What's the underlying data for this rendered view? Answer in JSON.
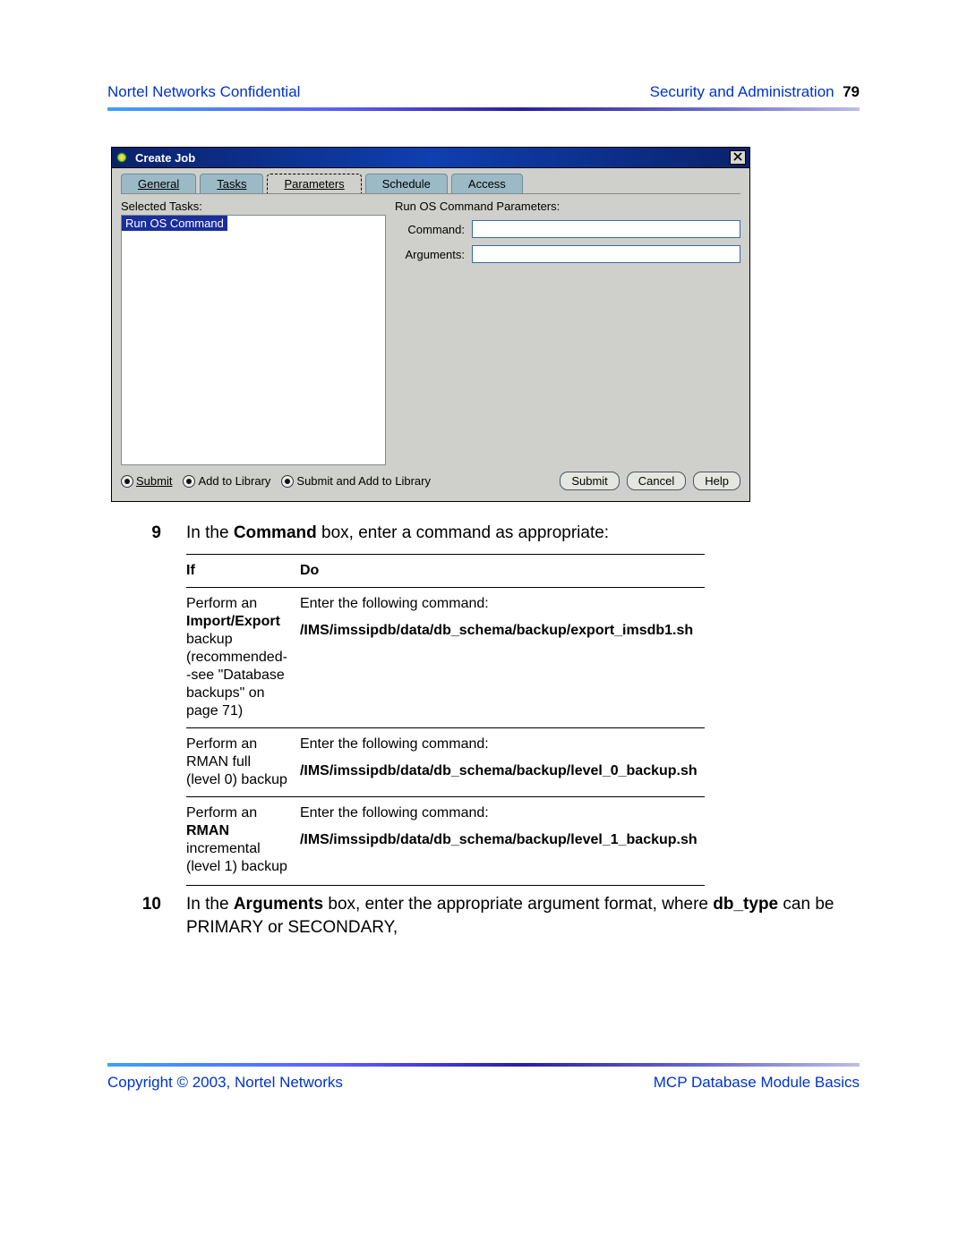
{
  "header": {
    "left": "Nortel Networks Confidential",
    "section": "Security and Administration",
    "page": "79"
  },
  "window": {
    "title": "Create Job",
    "tabs": {
      "general": "General",
      "tasks": "Tasks",
      "parameters": "Parameters",
      "schedule": "Schedule",
      "access": "Access"
    },
    "selectedTasksLabel": "Selected Tasks:",
    "selectedTaskItem": "Run OS Command",
    "paramsHeader": "Run OS Command Parameters:",
    "commandLabel": "Command:",
    "argumentsLabel": "Arguments:",
    "commandValue": "",
    "argumentsValue": "",
    "radios": {
      "submit": "Submit",
      "addlib": "Add to Library",
      "both": "Submit and Add to Library"
    },
    "buttons": {
      "submit": "Submit",
      "cancel": "Cancel",
      "help": "Help"
    }
  },
  "steps": {
    "s9": {
      "num": "9",
      "pre": "In the ",
      "bold": "Command",
      "post": " box, enter a command as appropriate:"
    },
    "tableHeader": {
      "if": "If",
      "do": "Do"
    },
    "rows": [
      {
        "if_pre": "Perform an ",
        "if_bold": "Import/Export",
        "if_post": " backup (recommended--see \"Database backups\" on page 71)",
        "do_lead": "Enter the following command:",
        "do_cmd": "/IMS/imssipdb/data/db_schema/backup/export_imsdb1.sh"
      },
      {
        "if_pre": "Perform an RMAN full (level 0) backup",
        "if_bold": "",
        "if_post": "",
        "do_lead": "Enter the following command:",
        "do_cmd": "/IMS/imssipdb/data/db_schema/backup/level_0_backup.sh"
      },
      {
        "if_pre": "Perform an ",
        "if_bold": "RMAN",
        "if_post": " incremental (level 1) backup",
        "do_lead": "Enter the following command:",
        "do_cmd": "/IMS/imssipdb/data/db_schema/backup/level_1_backup.sh"
      }
    ],
    "s10": {
      "num": "10",
      "pre": "In the ",
      "bold1": "Arguments",
      "mid": " box, enter the appropriate argument format, where ",
      "bold2": "db_type",
      "post": " can be PRIMARY or SECONDARY,"
    }
  },
  "footer": {
    "left": "Copyright © 2003, Nortel Networks",
    "right": "MCP Database Module Basics"
  }
}
